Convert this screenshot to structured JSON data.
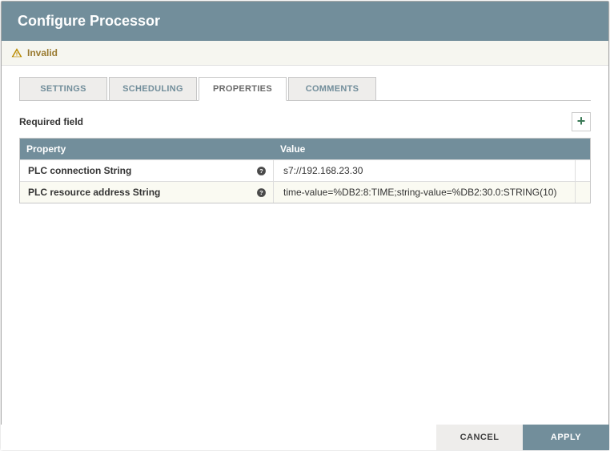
{
  "dialog": {
    "title": "Configure Processor",
    "status": "Invalid"
  },
  "tabs": {
    "settings": "SETTINGS",
    "scheduling": "SCHEDULING",
    "properties": "PROPERTIES",
    "comments": "COMMENTS"
  },
  "section": {
    "required_label": "Required field"
  },
  "table": {
    "header_property": "Property",
    "header_value": "Value",
    "rows": [
      {
        "name": "PLC connection String",
        "value": "s7://192.168.23.30"
      },
      {
        "name": "PLC resource address String",
        "value": "time-value=%DB2:8:TIME;string-value=%DB2:30.0:STRING(10)"
      }
    ]
  },
  "buttons": {
    "add": "+",
    "cancel": "CANCEL",
    "apply": "APPLY"
  }
}
